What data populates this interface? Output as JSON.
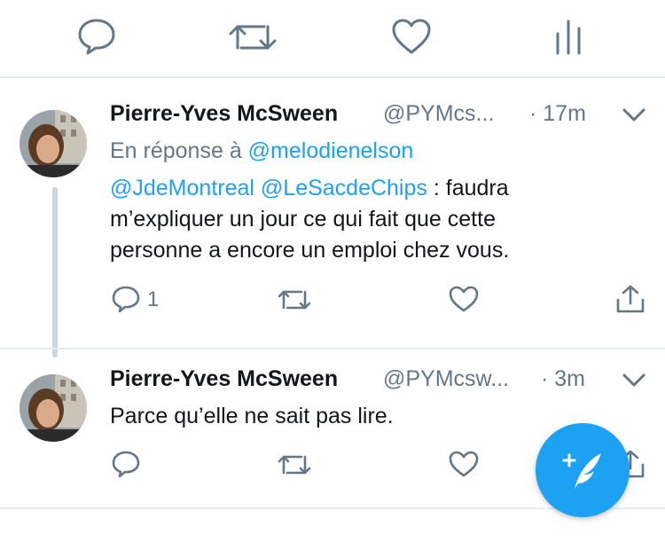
{
  "top_actions": [
    "reply-icon",
    "retweet-icon",
    "like-icon",
    "stats-icon"
  ],
  "tweets": [
    {
      "author_name": "Pierre-Yves McSween",
      "handle": "@PYMcs...",
      "time": "· 17m",
      "reply_prefix": "En réponse à",
      "reply_to": "@melodienelson",
      "mentions": [
        "@JdeMontreal",
        "@LeSacdeChips"
      ],
      "text_after_mentions": " : faudra",
      "text_lines": [
        "m’expliquer un jour ce qui fait que cette",
        "personne a encore un emploi chez vous."
      ],
      "reply_count": "1"
    },
    {
      "author_name": "Pierre-Yves McSween",
      "handle": "@PYMcsw...",
      "time": "· 3m",
      "text": "Parce qu’elle ne sait pas lire."
    }
  ],
  "compose_button": "compose-tweet-icon",
  "colors": {
    "accent": "#1da1f2",
    "secondary_text": "#657786",
    "icon": "#657786",
    "divider": "#e6ecf0"
  }
}
